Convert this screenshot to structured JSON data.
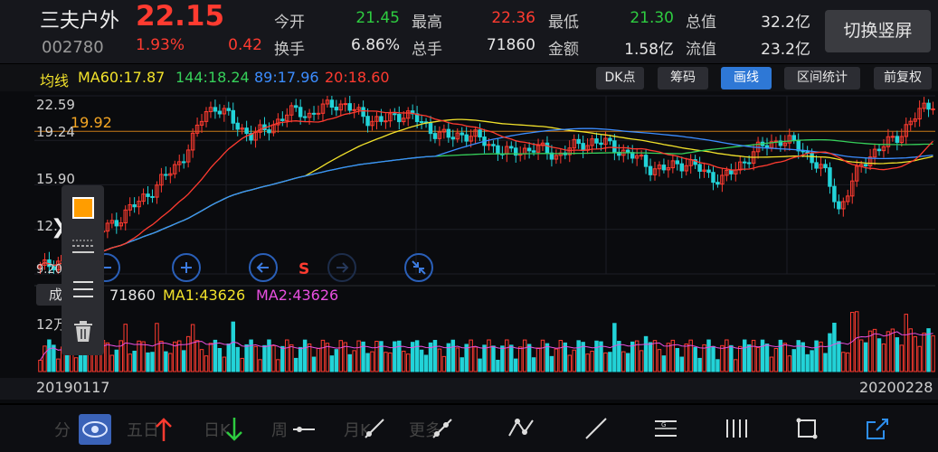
{
  "header": {
    "stock_name": "三夫户外",
    "price": "22.15",
    "stock_code": "002780",
    "change_pct": "1.93%",
    "change_amt": "0.42",
    "quotes": [
      {
        "label": "今开",
        "value": "21.45",
        "color": "green"
      },
      {
        "label": "最高",
        "value": "22.36",
        "color": "red"
      },
      {
        "label": "最低",
        "value": "21.30",
        "color": "green"
      },
      {
        "label": "总值",
        "value": "32.2亿",
        "color": "white"
      },
      {
        "label": "换手",
        "value": "6.86%",
        "color": "white"
      },
      {
        "label": "总手",
        "value": "71860",
        "color": "white"
      },
      {
        "label": "金额",
        "value": "1.58亿",
        "color": "white"
      },
      {
        "label": "流值",
        "value": "23.2亿",
        "color": "white"
      }
    ],
    "switch_button": "切换竖屏"
  },
  "ma_legend": {
    "title": "均线",
    "items": [
      {
        "text": "MA60:17.87",
        "color": "#f2e22b"
      },
      {
        "text": "144:18.24",
        "color": "#36d05a"
      },
      {
        "text": "89:17.96",
        "color": "#3c8dff"
      },
      {
        "text": "20:18.60",
        "color": "#ff3b30"
      }
    ]
  },
  "toolbar_buttons": [
    {
      "label": "DK点",
      "active": false
    },
    {
      "label": "筹码",
      "active": false
    },
    {
      "label": "画线",
      "active": true
    },
    {
      "label": "区间统计",
      "active": false
    },
    {
      "label": "前复权",
      "active": false
    }
  ],
  "price_axis": [
    "22.59",
    "19.24",
    "15.90",
    "12.",
    "9.20"
  ],
  "reference_line": "19.92",
  "nav_mark": "S",
  "volume_legend": {
    "label": "成",
    "volume": "71860",
    "ma1": "MA1:43626",
    "ma2": "MA2:43626",
    "scale": "12万"
  },
  "dates": {
    "start": "20190117",
    "end": "20200228"
  },
  "bottom_tabs": [
    "分",
    "五日",
    "日K",
    "周",
    "月K",
    "更多"
  ],
  "colors": {
    "up": "#ff3b30",
    "down": "#22d3d8",
    "ma60": "#f2e22b",
    "ma144": "#36d05a",
    "ma89": "#3c8dff",
    "ma20": "#ff3b30",
    "accent": "#2e78d6"
  },
  "chart_data": {
    "type": "candlestick",
    "x_range": [
      "20190117",
      "20200228"
    ],
    "ylim": [
      9.2,
      22.59
    ],
    "y_ticks": [
      22.59,
      19.24,
      15.9,
      12.55,
      9.2
    ],
    "reference_price": 19.92,
    "close_series_approx": [
      9.6,
      10.0,
      10.4,
      10.9,
      11.6,
      12.3,
      12.9,
      13.6,
      14.3,
      15.1,
      15.9,
      16.8,
      17.8,
      19.3,
      21.4,
      21.8,
      21.0,
      20.2,
      19.6,
      19.9,
      20.6,
      21.2,
      21.5,
      21.1,
      21.6,
      22.1,
      21.8,
      21.3,
      20.9,
      20.6,
      21.0,
      21.3,
      20.8,
      20.2,
      19.7,
      19.4,
      19.8,
      19.5,
      19.0,
      18.6,
      18.2,
      18.5,
      18.7,
      18.4,
      18.1,
      18.6,
      18.9,
      19.2,
      19.0,
      18.7,
      18.2,
      17.8,
      17.2,
      17.0,
      17.4,
      17.6,
      17.1,
      16.6,
      16.3,
      16.9,
      17.8,
      18.5,
      19.0,
      19.3,
      19.0,
      18.5,
      17.5,
      16.5,
      14.0,
      15.8,
      17.6,
      18.4,
      18.9,
      19.6,
      20.5,
      21.5,
      22.15
    ],
    "volume_ylim": [
      0,
      120000
    ],
    "volume_latest": 71860,
    "volume_ma1": 43626,
    "volume_ma2": 43626
  }
}
